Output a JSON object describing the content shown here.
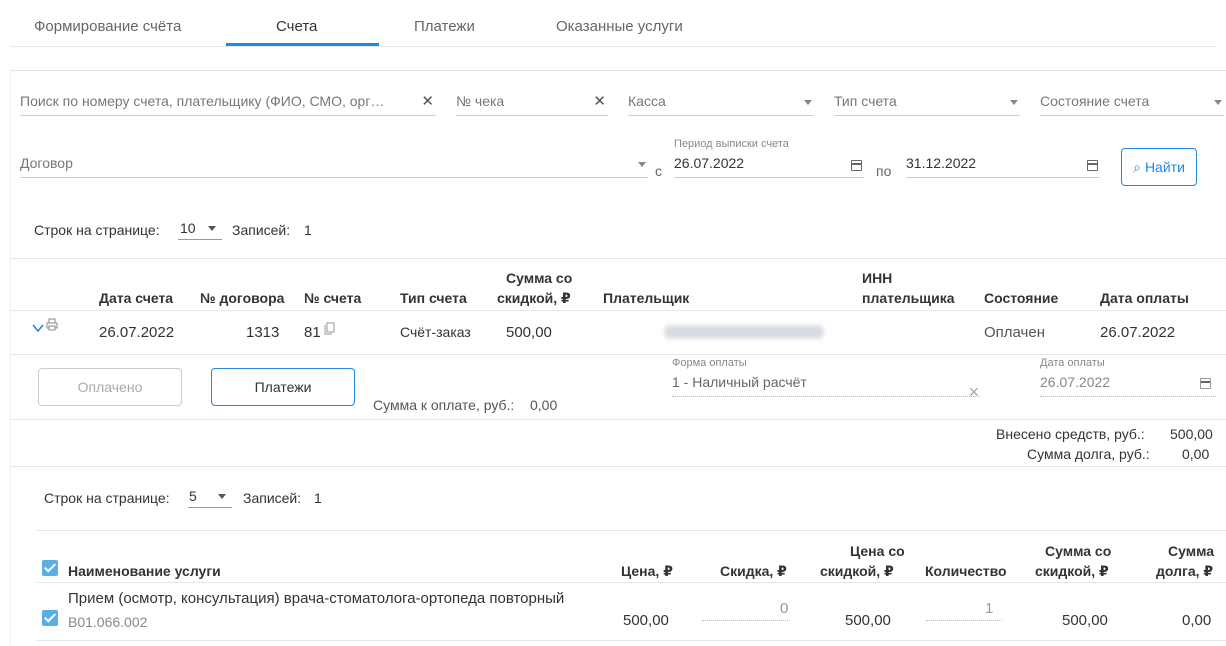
{
  "tabs": [
    {
      "label": "Формирование счёта"
    },
    {
      "label": "Счета"
    },
    {
      "label": "Платежи"
    },
    {
      "label": "Оказанные услуги"
    }
  ],
  "filters": {
    "search_placeholder": "Поиск по номеру счета, плательщику (ФИО, СМО, орг…",
    "check_placeholder": "№ чека",
    "kassa_placeholder": "Касса",
    "type_placeholder": "Тип счета",
    "state_placeholder": "Состояние счета",
    "contract_placeholder": "Договор",
    "period_label": "Период выписки счета",
    "from_prefix": "с",
    "date_from": "26.07.2022",
    "to_prefix": "по",
    "date_to": "31.12.2022",
    "find_button": "Найти"
  },
  "pagination_top": {
    "rows_label": "Строк на странице:",
    "rows_value": "10",
    "records_label": "Записей:",
    "records_value": "1"
  },
  "invoices_table": {
    "headers": {
      "date": "Дата счета",
      "contract": "№ договора",
      "number": "№ счета",
      "type": "Тип счета",
      "sum_line1": "Сумма со",
      "sum_line2": "скидкой, ₽",
      "payer": "Плательщик",
      "inn_line1": "ИНН",
      "inn_line2": "плательщика",
      "state": "Состояние",
      "pay_date": "Дата оплаты"
    },
    "row": {
      "date": "26.07.2022",
      "contract": "1313",
      "number": "81",
      "type": "Счёт-заказ",
      "sum": "500,00",
      "state": "Оплачен",
      "pay_date": "26.07.2022"
    }
  },
  "details": {
    "paid_button": "Оплачено",
    "payments_button": "Платежи",
    "to_pay_label": "Сумма к оплате, руб.:",
    "to_pay_value": "0,00",
    "pay_form_label": "Форма оплаты",
    "pay_form_value": "1 - Наличный расчёт",
    "pay_date_label": "Дата оплаты",
    "pay_date_value": "26.07.2022",
    "deposited_label": "Внесено средств, руб.:",
    "deposited_value": "500,00",
    "debt_label": "Сумма долга, руб.:",
    "debt_value": "0,00"
  },
  "pagination_services": {
    "rows_label": "Строк на странице:",
    "rows_value": "5",
    "records_label": "Записей:",
    "records_value": "1"
  },
  "services_table": {
    "headers": {
      "name": "Наименование услуги",
      "price": "Цена, ₽",
      "discount": "Скидка, ₽",
      "price_disc_line1": "Цена со",
      "price_disc_line2": "скидкой, ₽",
      "qty": "Количество",
      "sum_disc_line1": "Сумма со",
      "sum_disc_line2": "скидкой, ₽",
      "debt_line1": "Сумма",
      "debt_line2": "долга, ₽"
    },
    "row": {
      "name": "Прием (осмотр, консультация) врача-стоматолога-ортопеда повторный",
      "code": "B01.066.002",
      "price": "500,00",
      "discount": "0",
      "price_disc": "500,00",
      "qty": "1",
      "sum_disc": "500,00",
      "debt": "0,00"
    }
  },
  "colors": {
    "accent": "#1e88e5",
    "checkbox": "#5aaee6"
  }
}
